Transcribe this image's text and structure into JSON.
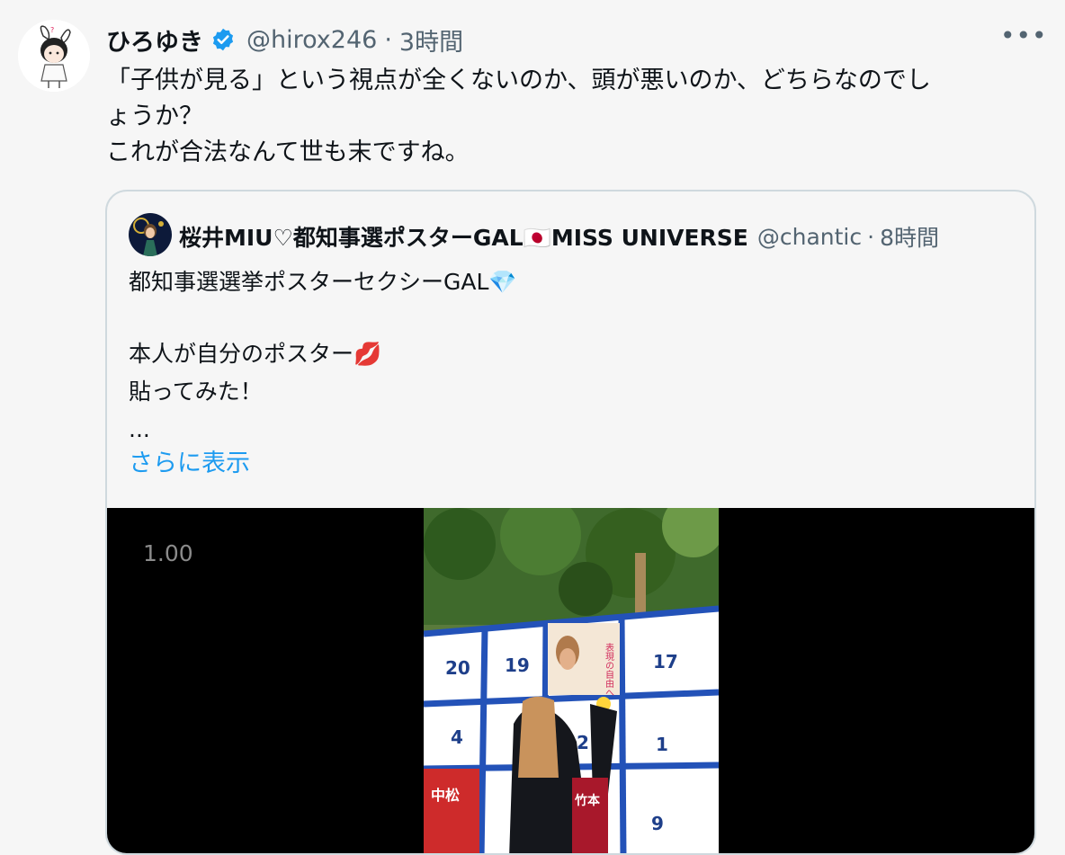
{
  "tweet": {
    "display_name": "ひろゆき",
    "handle": "@hirox246",
    "separator": "·",
    "time": "3時間",
    "more_label": "•••",
    "text_lines": [
      "「子供が見る」という視点が全くないのか、頭が悪いのか、どちらなのでし",
      "ょうか？",
      "これが合法なんて世も末ですね。"
    ]
  },
  "quote": {
    "display_name": "桜井MIU♡都知事選ポスターGAL🇯🇵MISS UNIVERSE",
    "handle": "@chantic",
    "separator": "·",
    "time": "8時間",
    "line1": "都知事選選挙ポスターセクシーGAL💎",
    "line2": "本人が自分のポスター💋",
    "line3": "貼ってみた！",
    "ellipsis": "...",
    "show_more": "さらに表示"
  },
  "media": {
    "speed_label": "1.00",
    "board_numbers": [
      "20",
      "19",
      "17",
      "4",
      "2",
      "1",
      "9"
    ],
    "poster_text": "表現の自由へ",
    "candidate_posters": [
      "中松",
      "竹本"
    ]
  },
  "colors": {
    "verified": "#1d9bf0",
    "link": "#1d9bf0",
    "secondary_text": "#536471",
    "border": "#cfd9de"
  }
}
